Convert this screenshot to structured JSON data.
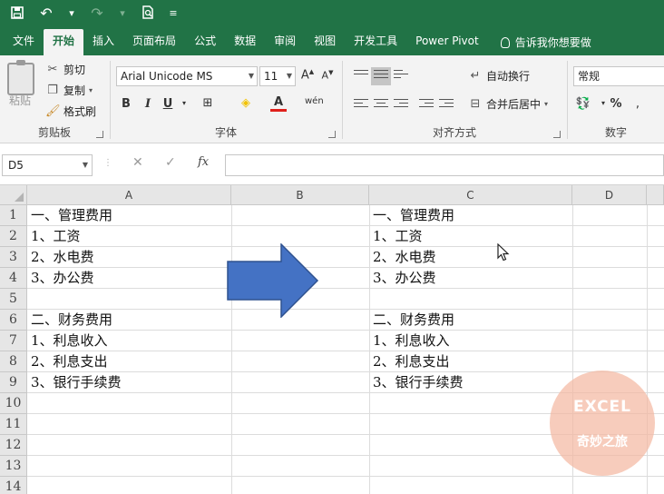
{
  "quick_access": {
    "save_icon": "save-icon",
    "undo_icon": "undo-icon",
    "redo_icon": "redo-icon",
    "print_preview_icon": "print-preview-icon",
    "customize_icon": "customize-icon"
  },
  "tabs": [
    {
      "label": "文件"
    },
    {
      "label": "开始"
    },
    {
      "label": "插入"
    },
    {
      "label": "页面布局"
    },
    {
      "label": "公式"
    },
    {
      "label": "数据"
    },
    {
      "label": "审阅"
    },
    {
      "label": "视图"
    },
    {
      "label": "开发工具"
    },
    {
      "label": "Power Pivot"
    }
  ],
  "tell_me": "告诉我你想要做",
  "ribbon": {
    "clipboard": {
      "paste": "粘贴",
      "cut": "剪切",
      "copy": "复制",
      "format_painter": "格式刷",
      "label": "剪贴板"
    },
    "font": {
      "name": "Arial Unicode MS",
      "size": "11",
      "bold": "B",
      "italic": "I",
      "underline": "U",
      "label": "字体"
    },
    "alignment": {
      "wrap_text": "自动换行",
      "merge_center": "合并后居中",
      "label": "对齐方式"
    },
    "number": {
      "format": "常规",
      "percent": "%",
      "label": "数字"
    }
  },
  "formula_bar": {
    "name_box": "D5",
    "cancel": "✕",
    "enter": "✓",
    "fx": "fx",
    "value": ""
  },
  "columns": [
    "A",
    "B",
    "C",
    "D"
  ],
  "rows": [
    "1",
    "2",
    "3",
    "4",
    "5",
    "6",
    "7",
    "8",
    "9",
    "10",
    "11",
    "12",
    "13",
    "14"
  ],
  "cells_A": [
    "一、管理费用",
    "1、工资",
    "2、水电费",
    "3、办公费",
    "",
    "二、财务费用",
    "1、利息收入",
    "2、利息支出",
    "3、银行手续费"
  ],
  "cells_C": [
    "一、管理费用",
    "1、工资",
    "2、水电费",
    "3、办公费",
    "",
    "二、财务费用",
    "1、利息收入",
    "2、利息支出",
    "3、银行手续费"
  ],
  "watermark": {
    "line1": "EXCEL",
    "line2": "奇妙之旅"
  },
  "colors": {
    "accent": "#217346",
    "arrow_fill": "#4472c4",
    "arrow_stroke": "#2f528f"
  }
}
